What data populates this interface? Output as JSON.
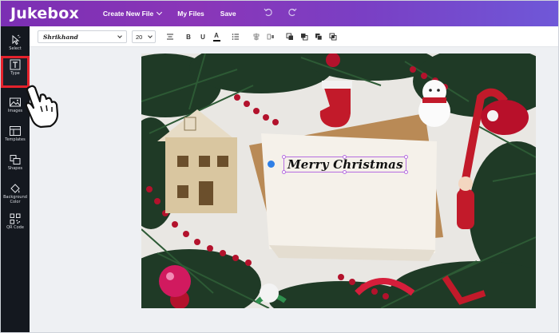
{
  "app": {
    "logo": "Jukebox"
  },
  "menu": {
    "create": "Create New File",
    "files": "My Files",
    "save": "Save"
  },
  "history": {
    "undo_icon": "undo-icon",
    "redo_icon": "redo-icon"
  },
  "sidebar": {
    "items": [
      {
        "label": "Select",
        "icon": "cursor-icon",
        "active": false
      },
      {
        "label": "Type",
        "icon": "type-icon",
        "active": true
      },
      {
        "label": "Images",
        "icon": "image-icon",
        "active": false
      },
      {
        "label": "Templates",
        "icon": "template-icon",
        "active": false
      },
      {
        "label": "Shapes",
        "icon": "shapes-icon",
        "active": false
      },
      {
        "label": "Background Color",
        "icon": "background-icon",
        "active": false
      },
      {
        "label": "QR Code",
        "icon": "qr-icon",
        "active": false
      }
    ]
  },
  "format": {
    "font": "Shrikhand",
    "size": "20",
    "bold": "B",
    "underline": "U",
    "color_letter": "A"
  },
  "canvas": {
    "text": "Merry Christmas"
  },
  "colors": {
    "accent": "#7b2fb3",
    "sidebar_bg": "#14181f",
    "active_outline": "#e4222c",
    "selection": "#b66ee0"
  }
}
